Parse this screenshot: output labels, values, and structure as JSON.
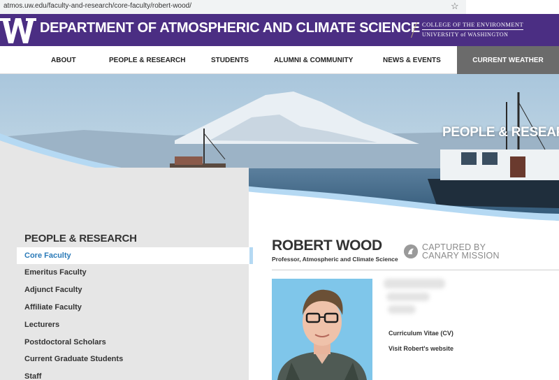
{
  "browser": {
    "url": "atmos.uw.edu/faculty-and-research/core-faculty/robert-wood/",
    "star_icon": "star-icon"
  },
  "header": {
    "logo_icon": "uw-w-logo",
    "title": "DEPARTMENT OF ATMOSPHERIC AND CLIMATE SCIENCE",
    "college_line1": "COLLEGE OF THE ENVIRONMENT",
    "college_line2": "UNIVERSITY of WASHINGTON",
    "colors": {
      "purple": "#4b2e83",
      "gold": "#b7a57a"
    }
  },
  "nav": {
    "items": [
      {
        "label": "ABOUT"
      },
      {
        "label": "PEOPLE & RESEARCH"
      },
      {
        "label": "STUDENTS"
      },
      {
        "label": "ALUMNI & COMMUNITY"
      },
      {
        "label": "NEWS & EVENTS"
      },
      {
        "label": "CURRENT WEATHER"
      }
    ]
  },
  "hero": {
    "title": "PEOPLE & RESEAR"
  },
  "sidebar": {
    "title": "PEOPLE & RESEARCH",
    "items": [
      {
        "label": "Core Faculty",
        "active": true
      },
      {
        "label": "Emeritus Faculty"
      },
      {
        "label": "Adjunct Faculty"
      },
      {
        "label": "Affiliate Faculty"
      },
      {
        "label": "Lecturers"
      },
      {
        "label": "Postdoctoral Scholars"
      },
      {
        "label": "Current Graduate Students"
      },
      {
        "label": "Staff"
      }
    ],
    "active_color": "#2a7ab8"
  },
  "profile": {
    "name": "ROBERT WOOD",
    "job_title": "Professor, Atmospheric and Climate Science",
    "badge_line1": "CAPTURED BY",
    "badge_line2": "CANARY MISSION",
    "badge_icon": "canary-mission-icon",
    "photo_icon": "profile-photo",
    "links": {
      "cv": "Curriculum Vitae (CV)",
      "website": "Visit Robert's website"
    }
  }
}
